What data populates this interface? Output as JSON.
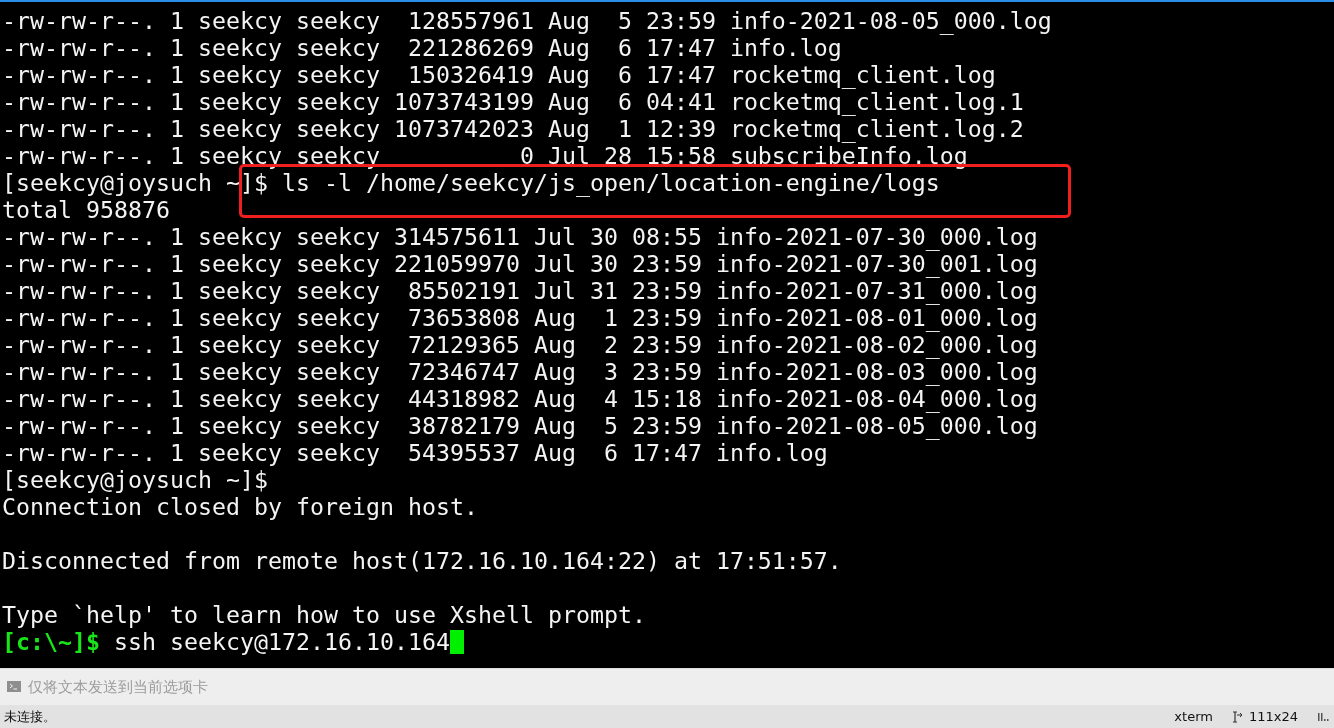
{
  "terminal": {
    "lines": [
      {
        "kind": "output",
        "text": "-rw-rw-r--. 1 seekcy seekcy  128557961 Aug  5 23:59 info-2021-08-05_000.log",
        "highlighted": false
      },
      {
        "kind": "output",
        "text": "-rw-rw-r--. 1 seekcy seekcy  221286269 Aug  6 17:47 info.log",
        "highlighted": false
      },
      {
        "kind": "output",
        "text": "-rw-rw-r--. 1 seekcy seekcy  150326419 Aug  6 17:47 rocketmq_client.log",
        "highlighted": false
      },
      {
        "kind": "output",
        "text": "-rw-rw-r--. 1 seekcy seekcy 1073743199 Aug  6 04:41 rocketmq_client.log.1",
        "highlighted": false
      },
      {
        "kind": "output",
        "text": "-rw-rw-r--. 1 seekcy seekcy 1073742023 Aug  1 12:39 rocketmq_client.log.2",
        "highlighted": false
      },
      {
        "kind": "output",
        "text": "-rw-rw-r--. 1 seekcy seekcy          0 Jul 28 15:58 subscribeInfo.log",
        "highlighted": false
      },
      {
        "kind": "output",
        "text": "[seekcy@joysuch ~]$ ls -l /home/seekcy/js_open/location-engine/logs",
        "highlighted": true
      },
      {
        "kind": "output",
        "text": "total 958876",
        "highlighted": false
      },
      {
        "kind": "output",
        "text": "-rw-rw-r--. 1 seekcy seekcy 314575611 Jul 30 08:55 info-2021-07-30_000.log",
        "highlighted": false
      },
      {
        "kind": "output",
        "text": "-rw-rw-r--. 1 seekcy seekcy 221059970 Jul 30 23:59 info-2021-07-30_001.log",
        "highlighted": false
      },
      {
        "kind": "output",
        "text": "-rw-rw-r--. 1 seekcy seekcy  85502191 Jul 31 23:59 info-2021-07-31_000.log",
        "highlighted": false
      },
      {
        "kind": "output",
        "text": "-rw-rw-r--. 1 seekcy seekcy  73653808 Aug  1 23:59 info-2021-08-01_000.log",
        "highlighted": false
      },
      {
        "kind": "output",
        "text": "-rw-rw-r--. 1 seekcy seekcy  72129365 Aug  2 23:59 info-2021-08-02_000.log",
        "highlighted": false
      },
      {
        "kind": "output",
        "text": "-rw-rw-r--. 1 seekcy seekcy  72346747 Aug  3 23:59 info-2021-08-03_000.log",
        "highlighted": false
      },
      {
        "kind": "output",
        "text": "-rw-rw-r--. 1 seekcy seekcy  44318982 Aug  4 15:18 info-2021-08-04_000.log",
        "highlighted": false
      },
      {
        "kind": "output",
        "text": "-rw-rw-r--. 1 seekcy seekcy  38782179 Aug  5 23:59 info-2021-08-05_000.log",
        "highlighted": false
      },
      {
        "kind": "output",
        "text": "-rw-rw-r--. 1 seekcy seekcy  54395537 Aug  6 17:47 info.log",
        "highlighted": false
      },
      {
        "kind": "output",
        "text": "[seekcy@joysuch ~]$",
        "highlighted": false
      },
      {
        "kind": "output",
        "text": "Connection closed by foreign host.",
        "highlighted": false
      },
      {
        "kind": "blank"
      },
      {
        "kind": "output",
        "text": "Disconnected from remote host(172.16.10.164:22) at 17:51:57.",
        "highlighted": false
      },
      {
        "kind": "blank"
      },
      {
        "kind": "output",
        "text": "Type `help' to learn how to use Xshell prompt.",
        "highlighted": false
      },
      {
        "kind": "local_prompt",
        "prompt": "[c:\\~]$",
        "command": "ssh seekcy@172.16.10.164",
        "cursor": true
      }
    ]
  },
  "compose_bar": {
    "placeholder": "仅将文本发送到当前选项卡"
  },
  "status_bar": {
    "connection": "未连接。",
    "terminal_type": "xterm",
    "size": "111x24"
  }
}
